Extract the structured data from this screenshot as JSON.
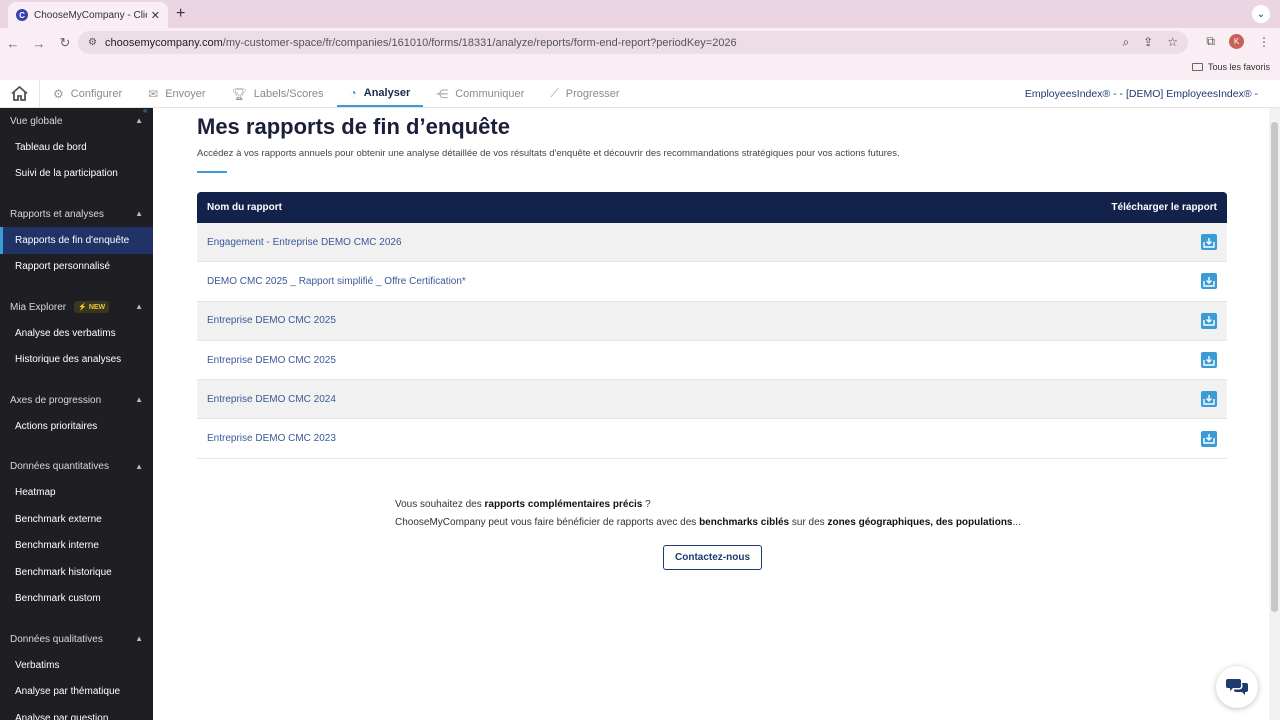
{
  "browser": {
    "tab_title": "ChooseMyCompany - ClientS",
    "url_host": "choosemycompany.com",
    "url_path": "/my-customer-space/fr/companies/161010/forms/18331/analyze/reports/form-end-report?periodKey=2026",
    "avatar_letter": "K",
    "bookmarks_folder": "Tous les favoris"
  },
  "appnav": {
    "items": [
      {
        "label": "Configurer",
        "icon": "gear-icon"
      },
      {
        "label": "Envoyer",
        "icon": "envelope-icon"
      },
      {
        "label": "Labels/Scores",
        "icon": "trophy-icon"
      },
      {
        "label": "Analyser",
        "icon": "pie-chart-icon",
        "active": true
      },
      {
        "label": "Communiquer",
        "icon": "share-icon"
      },
      {
        "label": "Progresser",
        "icon": "line-chart-icon"
      }
    ],
    "organization": "EmployeesIndex® - - [DEMO] EmployeesIndex® -"
  },
  "sidebar": {
    "sections": [
      {
        "title": "Vue globale",
        "items": [
          "Tableau de bord",
          "Suivi de la participation"
        ]
      },
      {
        "title": "Rapports et analyses",
        "items": [
          "Rapports de fin d'enquête",
          "Rapport personnalisé"
        ]
      },
      {
        "title": "Mia Explorer",
        "badge": "NEW",
        "items": [
          "Analyse des verbatims",
          "Historique des analyses"
        ]
      },
      {
        "title": "Axes de progression",
        "items": [
          "Actions prioritaires"
        ]
      },
      {
        "title": "Données quantitatives",
        "items": [
          "Heatmap",
          "Benchmark externe",
          "Benchmark interne",
          "Benchmark historique",
          "Benchmark custom"
        ]
      },
      {
        "title": "Données qualitatives",
        "items": [
          "Verbatims",
          "Analyse par thématique",
          "Analyse par question"
        ]
      }
    ]
  },
  "main": {
    "title": "Mes rapports de fin d’enquête",
    "subtitle": "Accédez à vos rapports annuels pour obtenir une analyse détaillée de vos résultats d'enquête et découvrir des recommandations stratégiques pour vos actions futures.",
    "table": {
      "col_name": "Nom du rapport",
      "col_download": "Télécharger le rapport",
      "rows": [
        "Engagement - Entreprise DEMO CMC 2026",
        "DEMO CMC 2025 _ Rapport simplifié _ Offre Certification*",
        "Entreprise DEMO CMC 2025",
        "Entreprise DEMO CMC 2025",
        "Entreprise DEMO CMC 2024",
        "Entreprise DEMO CMC 2023"
      ]
    },
    "promo": {
      "l1_a": "Vous souhaitez des ",
      "l1_b": "rapports complémentaires précis",
      "l1_c": " ?",
      "l2_a": "ChooseMyCompany peut vous faire bénéficier de rapports avec des ",
      "l2_b": "benchmarks ciblés",
      "l2_c": " sur des ",
      "l2_d": "zones géographiques, des populations",
      "l2_e": "..."
    },
    "contact_label": "Contactez-nous"
  },
  "colors": {
    "accent": "#3a9bd6",
    "header_navy": "#13224a",
    "sidebar_bg": "#1f1f23",
    "sidebar_active": "#213366"
  }
}
